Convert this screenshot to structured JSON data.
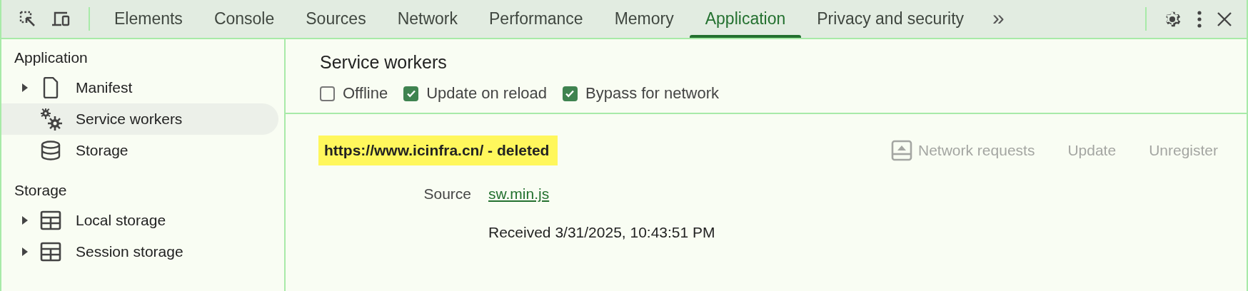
{
  "toolbar": {
    "tabs": [
      {
        "label": "Elements",
        "selected": false
      },
      {
        "label": "Console",
        "selected": false
      },
      {
        "label": "Sources",
        "selected": false
      },
      {
        "label": "Network",
        "selected": false
      },
      {
        "label": "Performance",
        "selected": false
      },
      {
        "label": "Memory",
        "selected": false
      },
      {
        "label": "Application",
        "selected": true
      },
      {
        "label": "Privacy and security",
        "selected": false
      }
    ],
    "more": "»"
  },
  "sidebar": {
    "sections": [
      {
        "title": "Application",
        "items": [
          {
            "label": "Manifest",
            "kind": "file",
            "expandable": true,
            "selected": false
          },
          {
            "label": "Service workers",
            "kind": "gears",
            "expandable": false,
            "selected": true
          },
          {
            "label": "Storage",
            "kind": "database",
            "expandable": false,
            "selected": false
          }
        ]
      },
      {
        "title": "Storage",
        "items": [
          {
            "label": "Local storage",
            "kind": "table",
            "expandable": true,
            "selected": false
          },
          {
            "label": "Session storage",
            "kind": "table",
            "expandable": true,
            "selected": false
          }
        ]
      }
    ]
  },
  "main": {
    "title": "Service workers",
    "options": [
      {
        "label": "Offline",
        "checked": false
      },
      {
        "label": "Update on reload",
        "checked": true
      },
      {
        "label": "Bypass for network",
        "checked": true
      }
    ],
    "worker": {
      "origin": "https://www.icinfra.cn/ - deleted",
      "actions": [
        {
          "label": "Network requests",
          "kind": "network",
          "disabled": true
        },
        {
          "label": "Update",
          "kind": "plain",
          "disabled": true
        },
        {
          "label": "Unregister",
          "kind": "plain",
          "disabled": true
        }
      ],
      "source_label": "Source",
      "source": "sw.min.js",
      "received": "Received 3/31/2025, 10:43:51 PM"
    }
  }
}
